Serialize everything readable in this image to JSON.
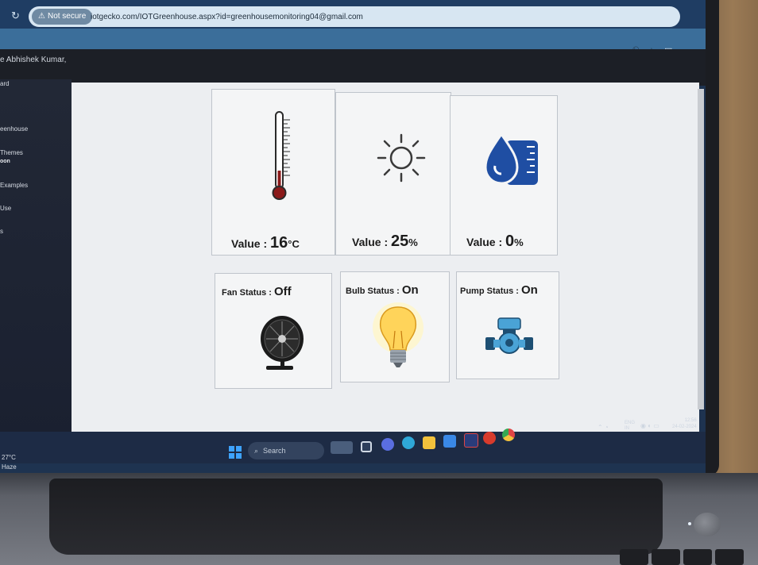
{
  "browser": {
    "security_label": "Not secure",
    "url": "iotgecko.com/IOTGreenhouse.aspx?id=greenhousemonitoring04@gmail.com"
  },
  "page": {
    "welcome": "e Abhishek Kumar,",
    "sidebar_items": [
      "ard",
      "eenhouse",
      "Themes",
      "oon",
      "Examples",
      "Use",
      "s"
    ]
  },
  "sensors": [
    {
      "label": "Value : ",
      "value": "16",
      "unit": "°C",
      "icon": "thermometer-icon"
    },
    {
      "label": "Value : ",
      "value": "25",
      "unit": "%",
      "icon": "sun-icon"
    },
    {
      "label": "Value : ",
      "value": "0",
      "unit": "%",
      "icon": "water-level-icon"
    }
  ],
  "devices": [
    {
      "label": "Fan Status : ",
      "state": "Off",
      "icon": "fan-icon"
    },
    {
      "label": "Bulb Status : ",
      "state": "On",
      "icon": "light-bulb-icon"
    },
    {
      "label": "Pump Status : ",
      "state": "On",
      "icon": "pump-icon"
    }
  ],
  "taskbar": {
    "weather_temp": "27°C",
    "weather_desc": "Haze",
    "search_placeholder": "Search",
    "lang_top": "ENG",
    "lang_bottom": "IN",
    "time": "12:56",
    "date": "24-02-2024"
  },
  "colors": {
    "icon_blue": "#1f4ea3",
    "thermo_red": "#8b1a1a",
    "start_blue": "#3ea3ff"
  }
}
